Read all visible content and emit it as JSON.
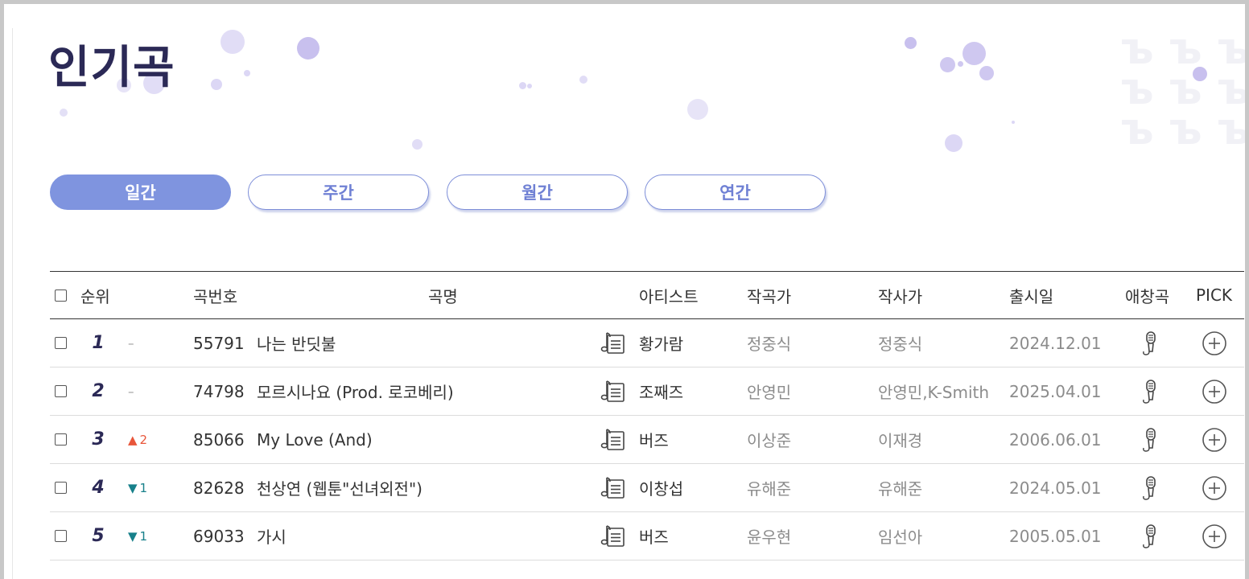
{
  "page": {
    "title": "인기곡"
  },
  "tabs": [
    {
      "label": "일간",
      "active": true
    },
    {
      "label": "주간",
      "active": false
    },
    {
      "label": "월간",
      "active": false
    },
    {
      "label": "연간",
      "active": false
    }
  ],
  "table": {
    "headers": {
      "rank": "순위",
      "song_no": "곡번호",
      "song_name": "곡명",
      "artist": "아티스트",
      "composer": "작곡가",
      "lyricist": "작사가",
      "release": "출시일",
      "favorite": "애창곡",
      "pick": "PICK"
    },
    "rows": [
      {
        "rank": "1",
        "change": "–",
        "dir": "none",
        "song_no": "55791",
        "song_name": "나는 반딧불",
        "artist": "황가람",
        "composer": "정중식",
        "lyricist": "정중식",
        "release": "2024.12.01"
      },
      {
        "rank": "2",
        "change": "–",
        "dir": "none",
        "song_no": "74798",
        "song_name": "모르시나요 (Prod. 로코베리)",
        "artist": "조째즈",
        "composer": "안영민",
        "lyricist": "안영민,K-Smith",
        "release": "2025.04.01"
      },
      {
        "rank": "3",
        "change": "2",
        "dir": "up",
        "song_no": "85066",
        "song_name": "My Love (And)",
        "artist": "버즈",
        "composer": "이상준",
        "lyricist": "이재경",
        "release": "2006.06.01"
      },
      {
        "rank": "4",
        "change": "1",
        "dir": "down",
        "song_no": "82628",
        "song_name": "천상연 (웹툰\"선녀외전\")",
        "artist": "이창섭",
        "composer": "유해준",
        "lyricist": "유해준",
        "release": "2024.05.01"
      },
      {
        "rank": "5",
        "change": "1",
        "dir": "down",
        "song_no": "69033",
        "song_name": "가시",
        "artist": "버즈",
        "composer": "윤우현",
        "lyricist": "임선아",
        "release": "2005.05.01"
      }
    ]
  },
  "icons": {
    "lyrics": "music-sheet-icon",
    "favorite": "microphone-icon",
    "pick": "plus-circle-icon",
    "up": "triangle-up-icon",
    "down": "triangle-down-icon"
  },
  "colors": {
    "title": "#2b2956",
    "tab_active_bg": "#7f94df",
    "tab_text": "#6f80d4",
    "up": "#e8563a",
    "down": "#17808a",
    "bubble": "#cfc8f0"
  }
}
